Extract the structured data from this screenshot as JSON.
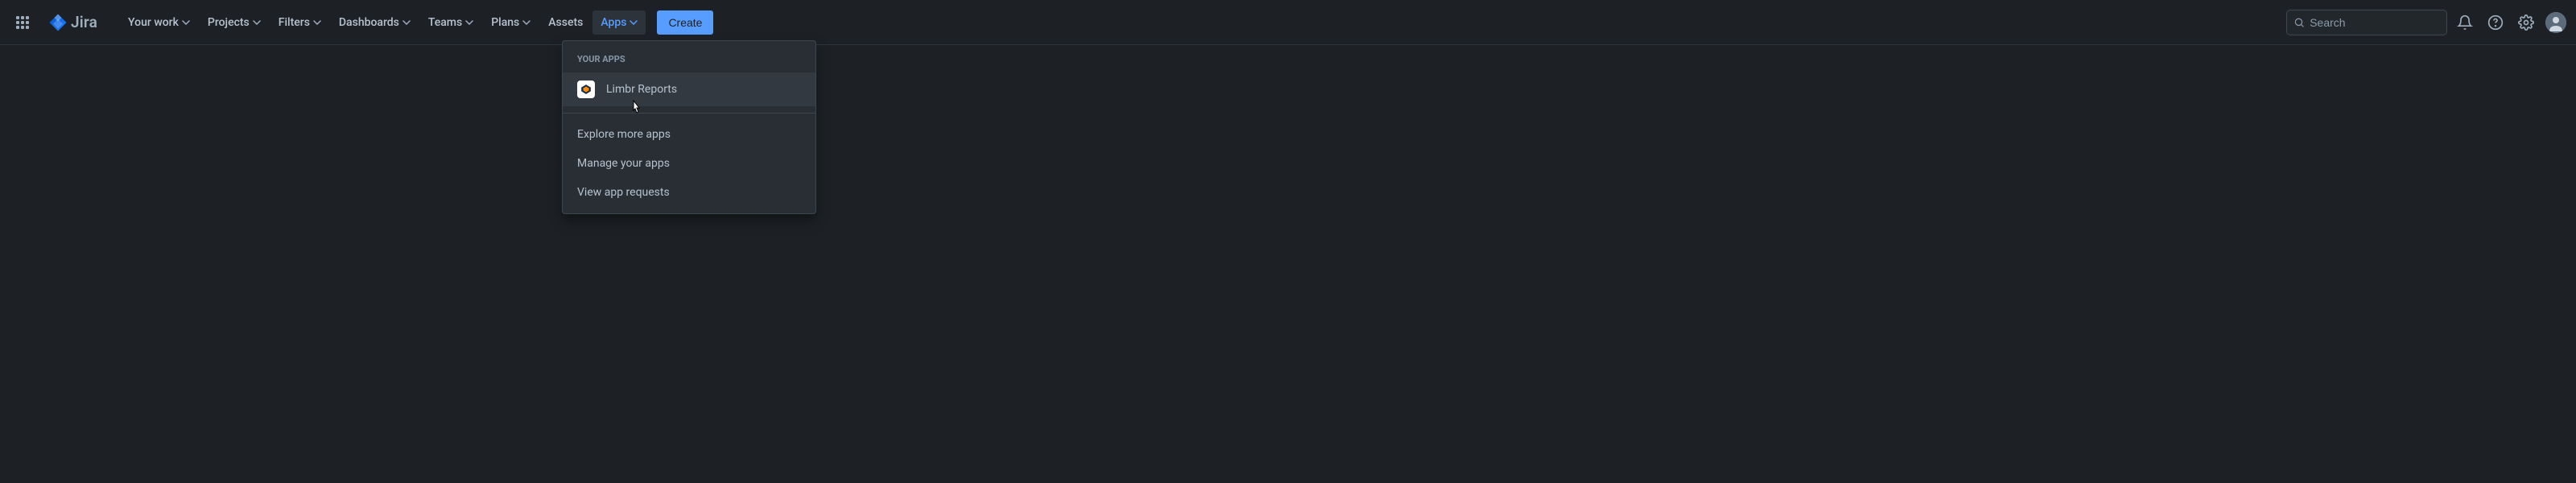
{
  "topbar": {
    "product_name": "Jira",
    "nav": [
      {
        "label": "Your work",
        "has_dropdown": true
      },
      {
        "label": "Projects",
        "has_dropdown": true
      },
      {
        "label": "Filters",
        "has_dropdown": true
      },
      {
        "label": "Dashboards",
        "has_dropdown": true
      },
      {
        "label": "Teams",
        "has_dropdown": true
      },
      {
        "label": "Plans",
        "has_dropdown": true
      },
      {
        "label": "Assets",
        "has_dropdown": false
      },
      {
        "label": "Apps",
        "has_dropdown": true,
        "active": true
      }
    ],
    "create_label": "Create",
    "search_placeholder": "Search"
  },
  "dropdown": {
    "section_header": "YOUR APPS",
    "apps": [
      {
        "name": "Limbr Reports"
      }
    ],
    "actions": [
      {
        "label": "Explore more apps"
      },
      {
        "label": "Manage your apps"
      },
      {
        "label": "View app requests"
      }
    ]
  }
}
